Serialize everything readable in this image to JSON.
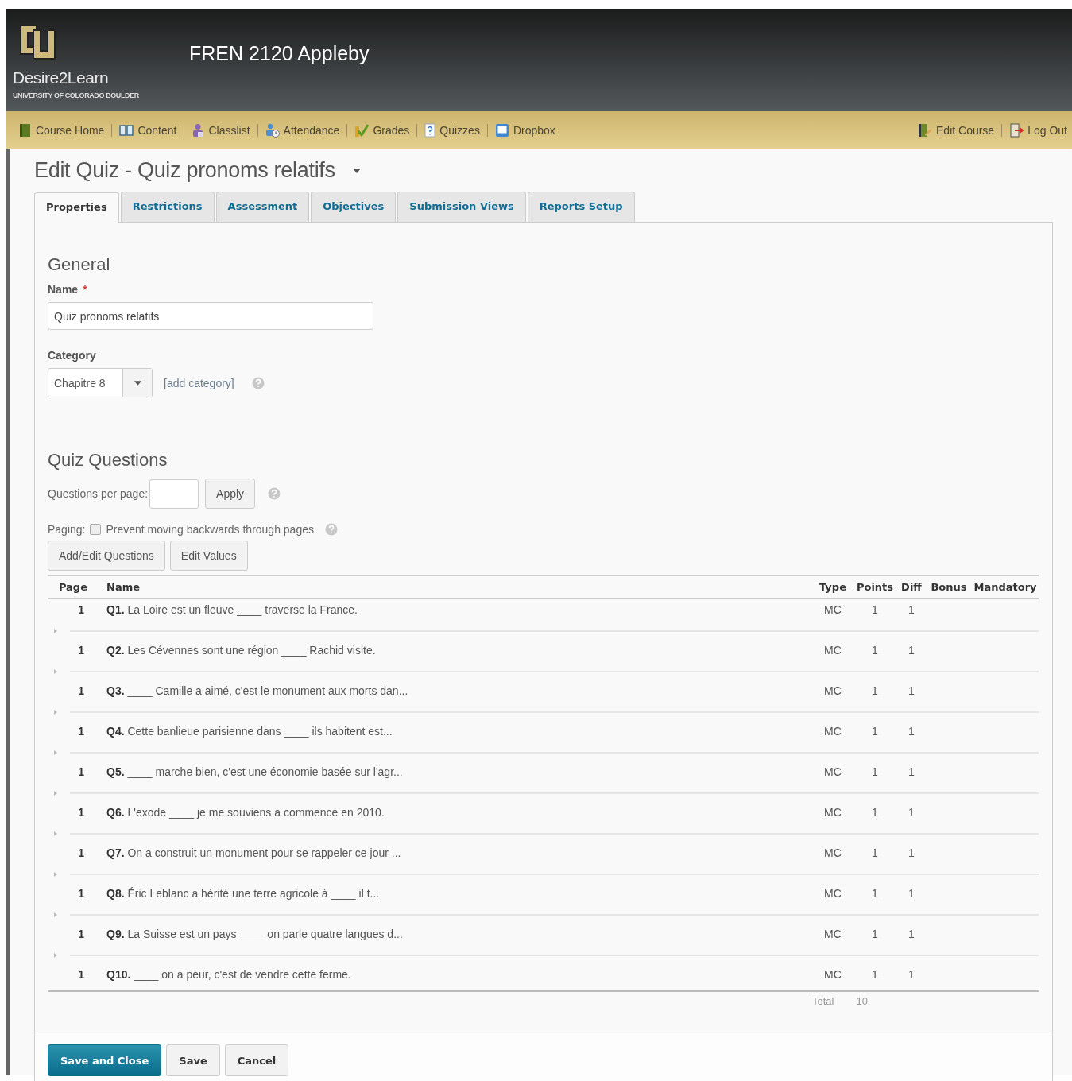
{
  "header": {
    "brand": "Desire2Learn",
    "brand_subtitle": "UNIVERSITY OF COLORADO BOULDER",
    "course_title": "FREN 2120 Appleby"
  },
  "nav": {
    "left": [
      "Course Home",
      "Content",
      "Classlist",
      "Attendance",
      "Grades",
      "Quizzes",
      "Dropbox"
    ],
    "right": [
      "Edit Course",
      "Log Out"
    ]
  },
  "page_title": "Edit Quiz - Quiz pronoms relatifs",
  "tabs": [
    {
      "label": "Properties",
      "selected": true
    },
    {
      "label": "Restrictions",
      "selected": false
    },
    {
      "label": "Assessment",
      "selected": false
    },
    {
      "label": "Objectives",
      "selected": false
    },
    {
      "label": "Submission Views",
      "selected": false
    },
    {
      "label": "Reports Setup",
      "selected": false
    }
  ],
  "general": {
    "heading": "General",
    "name_label": "Name",
    "required_mark": "*",
    "name_value": "Quiz pronoms relatifs",
    "category_label": "Category",
    "category_value": "Chapitre 8",
    "add_category": "[add category]"
  },
  "quiz_questions": {
    "heading": "Quiz Questions",
    "per_page_label": "Questions per page:",
    "apply_button": "Apply",
    "paging_label": "Paging:",
    "paging_option": {
      "label": "Prevent moving backwards through pages",
      "checked": false
    },
    "buttons": [
      "Add/Edit Questions",
      "Edit Values"
    ]
  },
  "table": {
    "columns": [
      "Page",
      "Name",
      "Type",
      "Points",
      "Diff",
      "Bonus",
      "Mandatory"
    ],
    "rows": [
      {
        "page": "1",
        "name": "**Q1.** La Loire est un fleuve ____ traverse la France.",
        "type": "MC",
        "points": "1",
        "diff": "1"
      },
      {
        "page": "1",
        "name": "**Q2.** Les Cévennes sont une région ____ Rachid visite.",
        "type": "MC",
        "points": "1",
        "diff": "1"
      },
      {
        "page": "1",
        "name": "**Q3.** ____ Camille a aimé, c'est le monument aux morts dan...",
        "type": "MC",
        "points": "1",
        "diff": "1"
      },
      {
        "page": "1",
        "name": "**Q4.** Cette banlieue parisienne dans ____ ils habitent est...",
        "type": "MC",
        "points": "1",
        "diff": "1"
      },
      {
        "page": "1",
        "name": "**Q5.** ____ marche bien, c'est une économie basée sur l'agr...",
        "type": "MC",
        "points": "1",
        "diff": "1"
      },
      {
        "page": "1",
        "name": "**Q6.** L'exode ____ je me souviens a commencé en 2010.",
        "type": "MC",
        "points": "1",
        "diff": "1"
      },
      {
        "page": "1",
        "name": "**Q7.** On a construit un monument pour se rappeler ce jour ...",
        "type": "MC",
        "points": "1",
        "diff": "1"
      },
      {
        "page": "1",
        "name": "**Q8.** Éric Leblanc a hérité une terre agricole à ____ il t...",
        "type": "MC",
        "points": "1",
        "diff": "1"
      },
      {
        "page": "1",
        "name": "**Q9.** La Suisse est un pays ____ on parle quatre langues d...",
        "type": "MC",
        "points": "1",
        "diff": "1"
      },
      {
        "page": "1",
        "name": "**Q10.** ____ on a peur, c'est de vendre cette ferme.",
        "type": "MC",
        "points": "1",
        "diff": "1"
      }
    ],
    "total_label": "Total",
    "total_value": "10"
  },
  "footer_buttons": [
    {
      "label": "Save and Close",
      "kind": "primary"
    },
    {
      "label": "Save",
      "kind": "normal"
    },
    {
      "label": "Cancel",
      "kind": "normal"
    }
  ]
}
